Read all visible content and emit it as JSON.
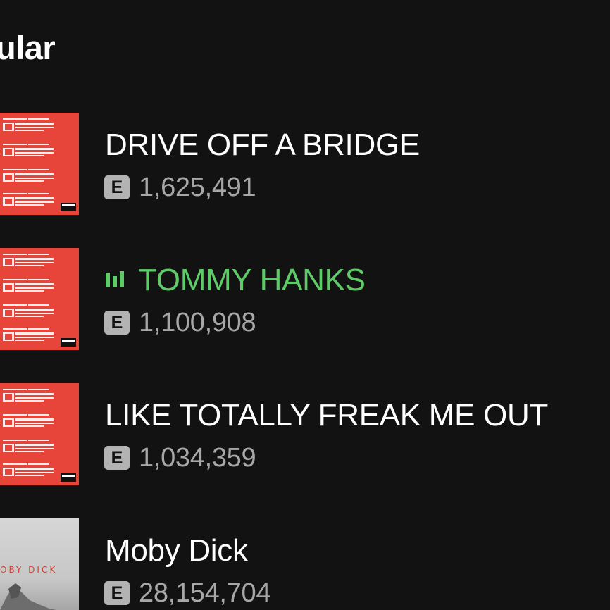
{
  "section": {
    "title": "ular"
  },
  "tracks": [
    {
      "title": "DRIVE OFF A BRIDGE",
      "explicit_label": "E",
      "plays": "1,625,491",
      "playing": false,
      "cover": "restricted-red"
    },
    {
      "title": "TOMMY HANKS",
      "explicit_label": "E",
      "plays": "1,100,908",
      "playing": true,
      "cover": "restricted-red"
    },
    {
      "title": "LIKE TOTALLY FREAK ME OUT",
      "explicit_label": "E",
      "plays": "1,034,359",
      "playing": false,
      "cover": "restricted-red"
    },
    {
      "title": "Moby Dick",
      "explicit_label": "E",
      "plays": "28,154,704",
      "playing": false,
      "cover": "moby-dick-grey",
      "cover_text": "OBY DICK"
    }
  ],
  "icons": {
    "now_playing": "equalizer-bars-icon"
  },
  "colors": {
    "background": "#121212",
    "text_primary": "#ffffff",
    "text_secondary": "#a7a7a7",
    "playing_accent": "#5fcb68",
    "explicit_badge": "#b3b3b3",
    "cover_red": "#e8453a"
  }
}
